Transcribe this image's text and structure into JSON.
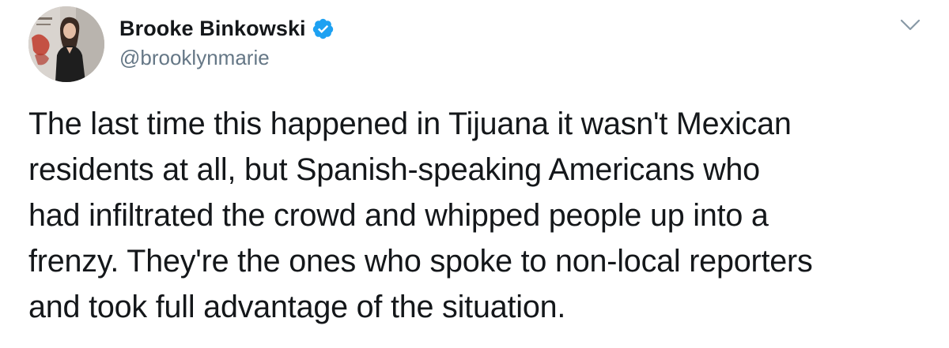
{
  "tweet": {
    "author": {
      "display_name": "Brooke Binkowski",
      "handle": "@brooklynmarie",
      "verified": true,
      "avatar_icon": "profile-photo"
    },
    "menu_icon": "chevron-down-icon",
    "text": "The last time this happened in Tijuana it wasn't Mexican\nresidents at all, but Spanish-speaking Americans who\nhad infiltrated the crowd and whipped people up into a\nfrenzy. They're the ones who spoke to non-local reporters\nand took full advantage of the situation."
  },
  "colors": {
    "verified_badge": "#1da1f2",
    "handle_text": "#657786",
    "body_text": "#14171a",
    "chevron": "#8899a6"
  }
}
